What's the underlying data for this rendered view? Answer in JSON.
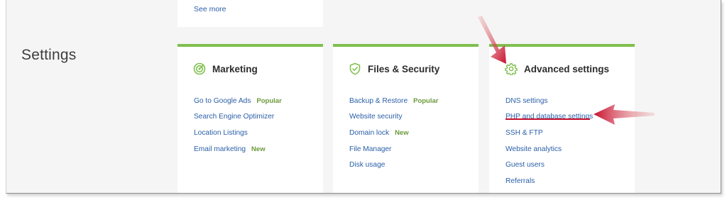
{
  "section": {
    "title": "Settings"
  },
  "top_card": {
    "see_more": "See more"
  },
  "cards": {
    "marketing": {
      "title": "Marketing",
      "icon": "target-icon",
      "links": [
        {
          "label": "Go to Google Ads",
          "badge": "Popular"
        },
        {
          "label": "Search Engine Optimizer",
          "badge": ""
        },
        {
          "label": "Location Listings",
          "badge": ""
        },
        {
          "label": "Email marketing",
          "badge": "New"
        }
      ]
    },
    "files": {
      "title": "Files & Security",
      "icon": "shield-check-icon",
      "links": [
        {
          "label": "Backup & Restore",
          "badge": "Popular"
        },
        {
          "label": "Website security",
          "badge": ""
        },
        {
          "label": "Domain lock",
          "badge": "New"
        },
        {
          "label": "File Manager",
          "badge": ""
        },
        {
          "label": "Disk usage",
          "badge": ""
        }
      ]
    },
    "advanced": {
      "title": "Advanced settings",
      "icon": "gear-icon",
      "links": [
        {
          "label": "DNS settings",
          "badge": ""
        },
        {
          "label": "PHP and database settings",
          "badge": ""
        },
        {
          "label": "SSH & FTP",
          "badge": ""
        },
        {
          "label": "Website analytics",
          "badge": ""
        },
        {
          "label": "Guest users",
          "badge": ""
        },
        {
          "label": "Referrals",
          "badge": ""
        }
      ]
    }
  },
  "colors": {
    "accent": "#7fbf4d",
    "link": "#2a5fa8",
    "badge": "#6b9a3a",
    "annotation": "#c8102e"
  }
}
